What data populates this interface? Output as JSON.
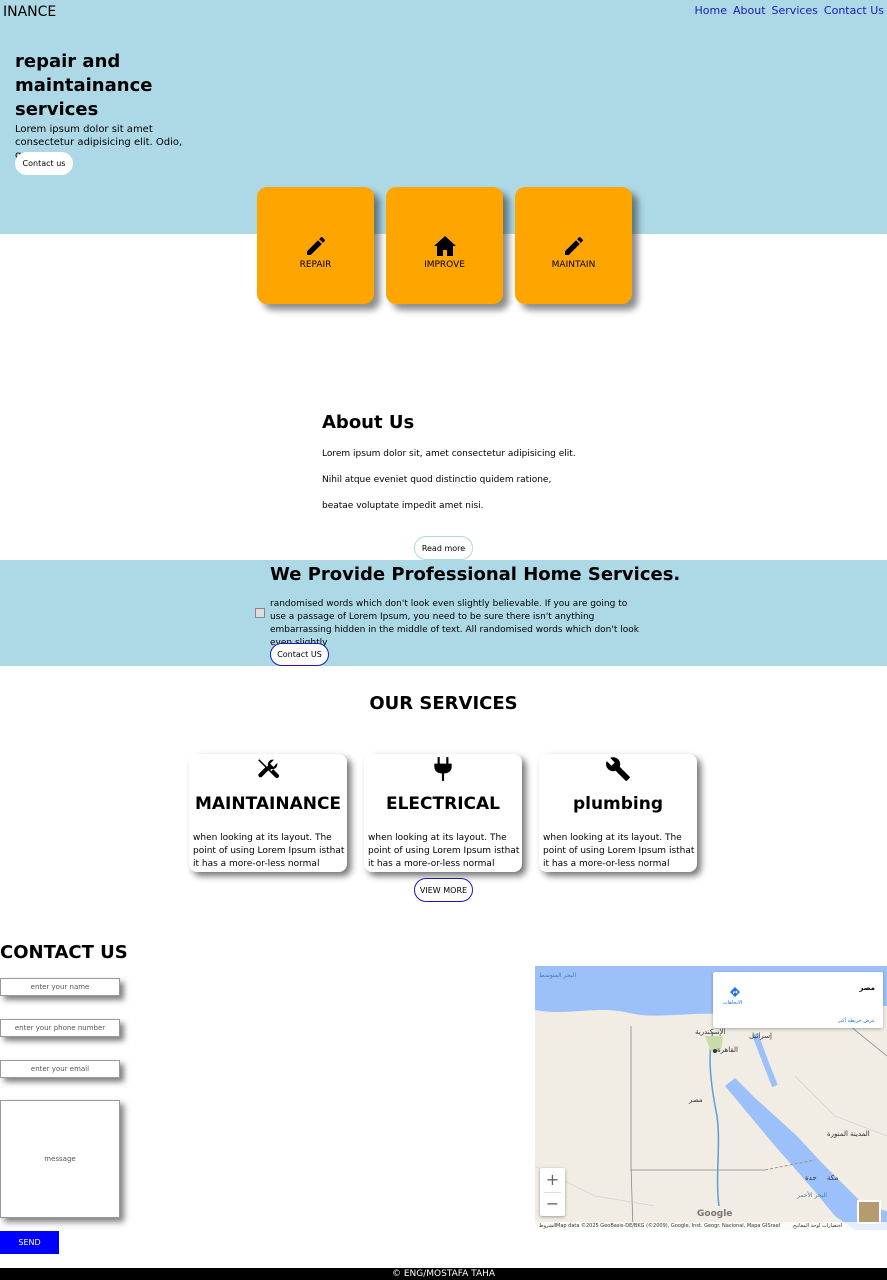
{
  "header": {
    "brand": "INANCE",
    "nav": [
      "Home",
      "About",
      "Services",
      "Contact Us"
    ]
  },
  "hero": {
    "title": "repair and maintainance services",
    "text": "Lorem ipsum dolor sit amet consectetur adipisicing elit. Odio, quam.",
    "button": "Contact us"
  },
  "tiles": [
    {
      "label": "REPAIR",
      "icon": "pencil-icon"
    },
    {
      "label": "IMPROVE",
      "icon": "home-icon"
    },
    {
      "label": "MAINTAIN",
      "icon": "pencil-icon"
    }
  ],
  "about": {
    "title": "About Us",
    "lines": [
      "Lorem ipsum dolor sit, amet consectetur adipisicing elit.",
      "Nihil atque eveniet quod distinctio quidem ratione,",
      "beatae voluptate impedit amet nisi."
    ],
    "button": "Read more"
  },
  "provide": {
    "title": "We Provide Professional Home Services.",
    "text": "randomised words which don't look even slightly believable. If you are going to use a passage of Lorem Ipsum, you need to be sure there isn't anything embarrassing hidden in the middle of text. All randomised words which don't look even slightly",
    "button": "Contact US"
  },
  "services": {
    "title": "OUR SERVICES",
    "cards": [
      {
        "icon": "tools-icon",
        "title": "MAINTAINANCE",
        "text": "when looking at its layout. The point of using Lorem Ipsum isthat it has a more-or-less normal"
      },
      {
        "icon": "plug-icon",
        "title": "ELECTRICAL",
        "text": "when looking at its layout. The point of using Lorem Ipsum isthat it has a more-or-less normal"
      },
      {
        "icon": "wrench-icon",
        "title": "plumbing",
        "text": "when looking at its layout. The point of using Lorem Ipsum isthat it has a more-or-less normal"
      }
    ],
    "button": "VIEW MORE"
  },
  "contact": {
    "title": "CONTACT US",
    "name_placeholder": "enter your name",
    "phone_placeholder": "enter your phone number",
    "email_placeholder": "enter your email",
    "message_placeholder": "message",
    "send": "SEND"
  },
  "map": {
    "card_title": "مصر",
    "card_link": "عرض خريطة أكبر",
    "directions": "الاتجاهات",
    "labels": [
      "الإسكندرية",
      "القاهرة",
      "إسرائيل",
      "مصر",
      "المدينة المنورة",
      "مكة",
      "جدة"
    ],
    "sea_labels": [
      "البحر المتوسط",
      "البحر الأحمر"
    ],
    "zoom_in": "+",
    "zoom_out": "−",
    "google": "Google",
    "attribution_left": "الشروط",
    "attribution": "Map data ©2025 GeoBasis-DE/BKG (©2009), Google, Inst. Geogr. Nacional, Mapa GISrael",
    "attribution_right": "اختصارات لوحة المفاتيح"
  },
  "footer": "© ENG/MOSTAFA TAHA"
}
